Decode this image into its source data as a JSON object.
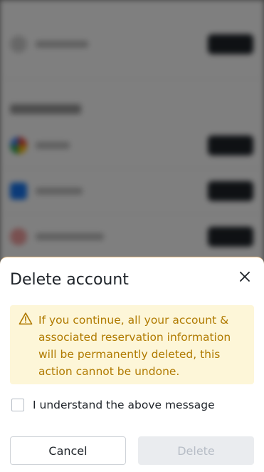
{
  "dialog": {
    "title": "Delete account",
    "warning": "If you continue, all your account & associated reservation information will be permanently deleted, this action cannot be undone.",
    "checkbox_label": "I understand the above message",
    "checkbox_checked": false,
    "cancel_label": "Cancel",
    "delete_label": "Delete",
    "delete_enabled": false
  },
  "icons": {
    "close": "close-icon",
    "warning": "warning-icon"
  },
  "colors": {
    "warning_bg": "#fdf6d8",
    "warning_text": "#b07a00",
    "sheet_border": "#e8b97a",
    "text_primary": "#1e2329",
    "disabled_bg": "#eaecef",
    "disabled_text": "#b7bdc6"
  }
}
